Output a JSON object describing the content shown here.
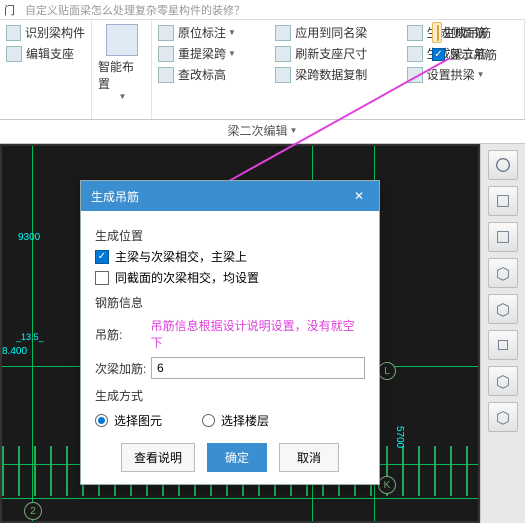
{
  "titlebar": {
    "name": "门",
    "question": "自定义贴面梁怎么处理复杂零星构件的装修？"
  },
  "ribbon": {
    "g1": {
      "b1": "识别梁构件",
      "b2": "编辑支座"
    },
    "g2": {
      "label": "智能布置"
    },
    "g3": {
      "r1c1": "原位标注",
      "r1c2": "应用到同名梁",
      "r1c3": "生成侧面筋",
      "r1c4": "生成吊筋",
      "r2c1": "重提梁跨",
      "r2c2": "刷新支座尺寸",
      "r2c3": "生成架立筋",
      "r2c4": "显示吊筋",
      "r3c1": "查改标高",
      "r3c2": "梁跨数据复制",
      "r3c3": "设置拱梁"
    }
  },
  "tab": {
    "label": "梁二次编辑"
  },
  "canvas": {
    "dim1": "9300",
    "dim2": "8.400",
    "dim3": "5700",
    "dim4": "_13.5_",
    "axisL": "L",
    "axisK": "K",
    "axis2": "2"
  },
  "dialog": {
    "title": "生成吊筋",
    "s1": "生成位置",
    "opt1": "主梁与次梁相交，主梁上",
    "opt2": "同截面的次梁相交，均设置",
    "s2": "钢筋信息",
    "f1": "吊筋:",
    "f1hint": "吊筋信息根据设计说明设置，没有就空下",
    "f2": "次梁加筋:",
    "f2val": "6",
    "s3": "生成方式",
    "r1": "选择图元",
    "r2": "选择楼层",
    "bHelp": "查看说明",
    "bOk": "确定",
    "bCancel": "取消"
  }
}
